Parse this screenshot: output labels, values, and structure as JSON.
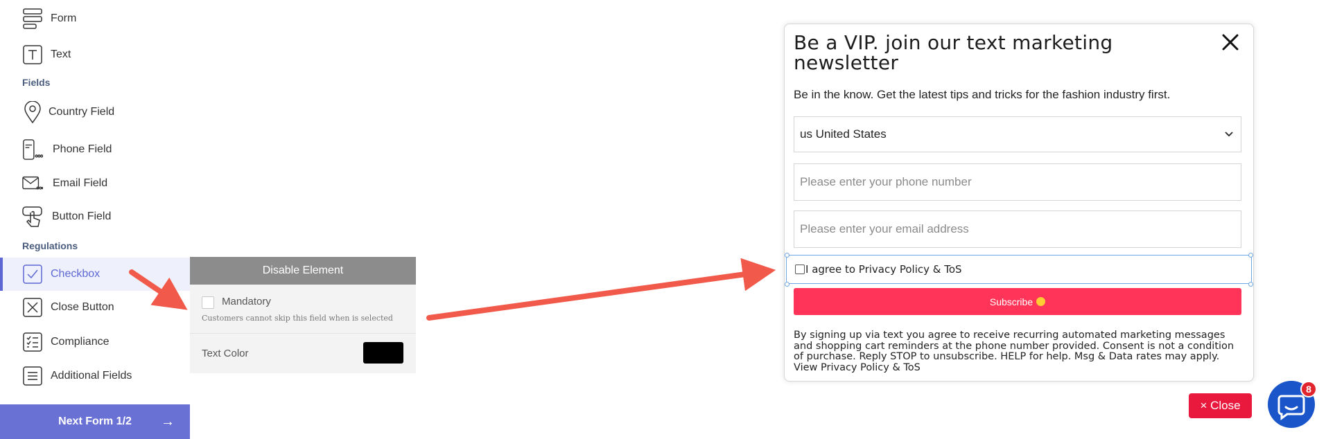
{
  "sidebar": {
    "items_top": [
      {
        "label": "Form",
        "icon": "form-icon"
      },
      {
        "label": "Text",
        "icon": "text-icon"
      }
    ],
    "sections": {
      "fields": "Fields",
      "regulations": "Regulations"
    },
    "field_items": [
      {
        "label": "Country Field",
        "icon": "location-pin-icon"
      },
      {
        "label": "Phone Field",
        "icon": "phone-icon"
      },
      {
        "label": "Email Field",
        "icon": "envelope-icon"
      },
      {
        "label": "Button Field",
        "icon": "pointer-hand-icon"
      }
    ],
    "regulation_items": [
      {
        "label": "Checkbox",
        "icon": "checkbox-icon",
        "active": true
      },
      {
        "label": "Close Button",
        "icon": "close-square-icon"
      },
      {
        "label": "Compliance",
        "icon": "checklist-icon"
      },
      {
        "label": "Additional Fields",
        "icon": "list-icon"
      }
    ],
    "next_button": {
      "label": "Next Form 1/2",
      "icon": "arrow-right-icon"
    }
  },
  "properties": {
    "disable_label": "Disable Element",
    "mandatory_label": "Mandatory",
    "mandatory_help": "Customers cannot skip this field when is selected",
    "text_color_label": "Text Color",
    "text_color_value": "#000000"
  },
  "popup": {
    "title": "Be a VIP. join our text marketing newsletter",
    "subtitle": "Be in the know. Get the latest tips and tricks for the fashion industry first.",
    "country_select": "us United States",
    "phone_placeholder": "Please enter your phone number",
    "email_placeholder": "Please enter your email address",
    "agree_label": "I agree to Privacy Policy & ToS",
    "subscribe_label": "Subscribe",
    "legal_text": "By signing up via text you agree to receive recurring automated marketing messages and shopping cart reminders at the phone number provided. Consent is not a condition of purchase. Reply STOP to unsubscribe. HELP for help. Msg & Data rates may apply. View Privacy Policy & ToS"
  },
  "close_button": {
    "label": "× Close"
  },
  "chat": {
    "badge_count": "8"
  },
  "colors": {
    "accent": "#6a71d4",
    "subscribe": "#ff3458",
    "close": "#e8193c",
    "annotation_arrow": "#f15a4a",
    "chat": "#1a56c9"
  }
}
